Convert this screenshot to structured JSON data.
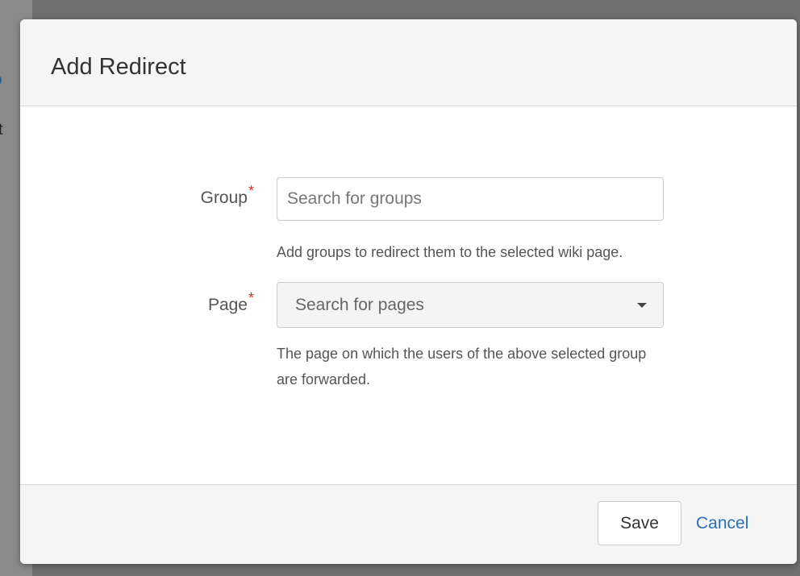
{
  "background": {
    "link_fragment": "to",
    "text_fragment": "st"
  },
  "dialog": {
    "title": "Add Redirect",
    "fields": {
      "group": {
        "label": "Group",
        "required_mark": "*",
        "placeholder": "Search for groups",
        "help": "Add groups to redirect them to the selected wiki page."
      },
      "page": {
        "label": "Page",
        "required_mark": "*",
        "placeholder": "Search for pages",
        "help_line1": "The page on which the users of the above selected group",
        "help_line2": "are forwarded."
      }
    },
    "footer": {
      "save_label": "Save",
      "cancel_label": "Cancel"
    }
  },
  "colors": {
    "required": "#d0342c",
    "link": "#2a6ebb",
    "backdrop": "#6f6f6f"
  },
  "icons": {
    "select_caret": "chevron-down-icon"
  }
}
